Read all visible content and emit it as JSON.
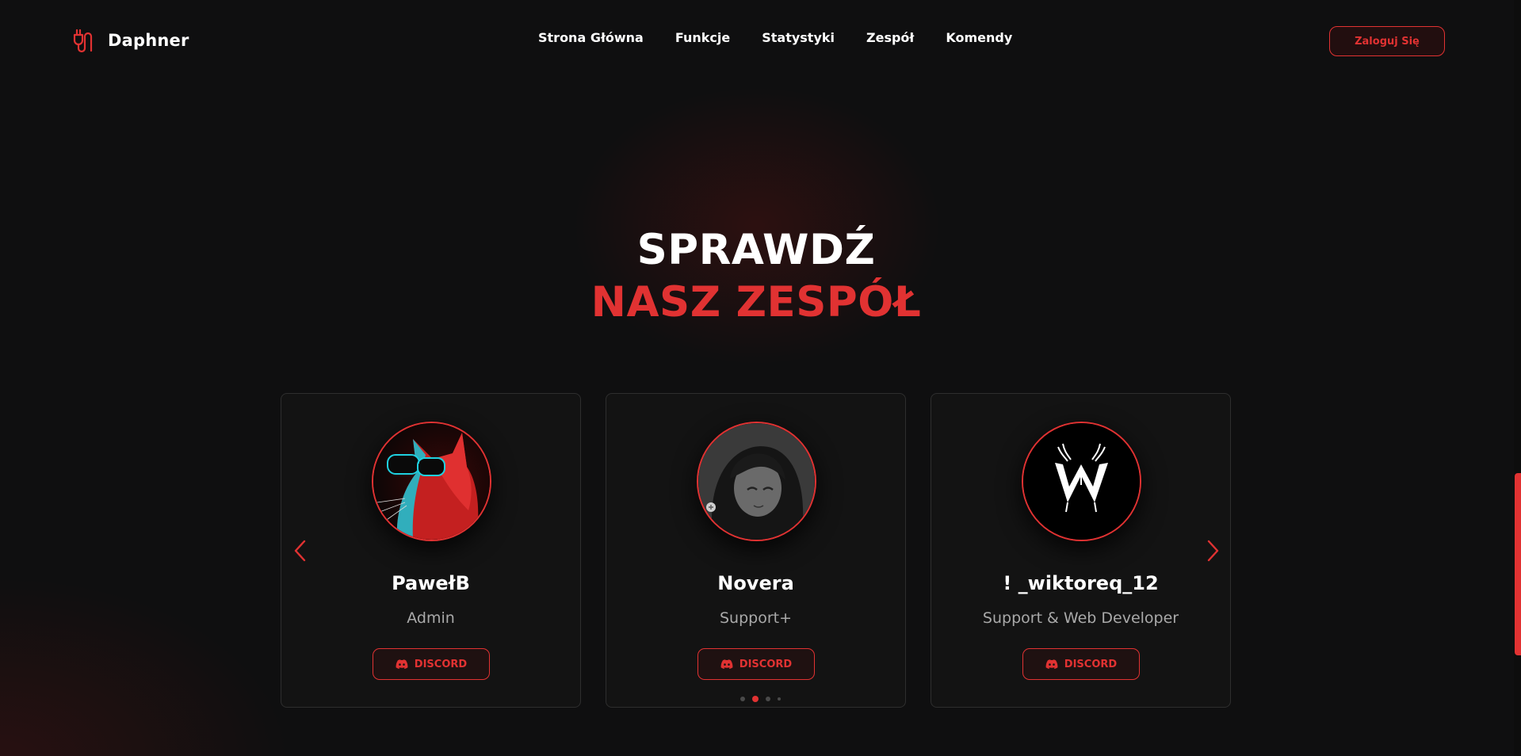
{
  "brand": {
    "name": "Daphner",
    "logo_icon": "plug-icon",
    "accent_color": "#e13232"
  },
  "nav": {
    "items": [
      {
        "label": "Strona Główna"
      },
      {
        "label": "Funkcje"
      },
      {
        "label": "Statystyki"
      },
      {
        "label": "Zespół"
      },
      {
        "label": "Komendy"
      }
    ],
    "login_label": "Zaloguj Się"
  },
  "hero": {
    "line1": "SPRAWDŹ",
    "line2": "NASZ ZESPÓŁ"
  },
  "team": {
    "members": [
      {
        "name": "PawełB",
        "role": "Admin",
        "button_label": "DISCORD",
        "avatar_icon": "cat-sunglasses-avatar"
      },
      {
        "name": "Novera",
        "role": "Support+",
        "button_label": "DISCORD",
        "avatar_icon": "anime-girl-avatar"
      },
      {
        "name": "! _wiktoreq_12",
        "role": "Support & Web Developer",
        "button_label": "DISCORD",
        "avatar_icon": "w-emblem-avatar"
      }
    ]
  },
  "carousel": {
    "prev_icon": "chevron-left-icon",
    "next_icon": "chevron-right-icon",
    "page_count": 4,
    "active_page": 2
  }
}
